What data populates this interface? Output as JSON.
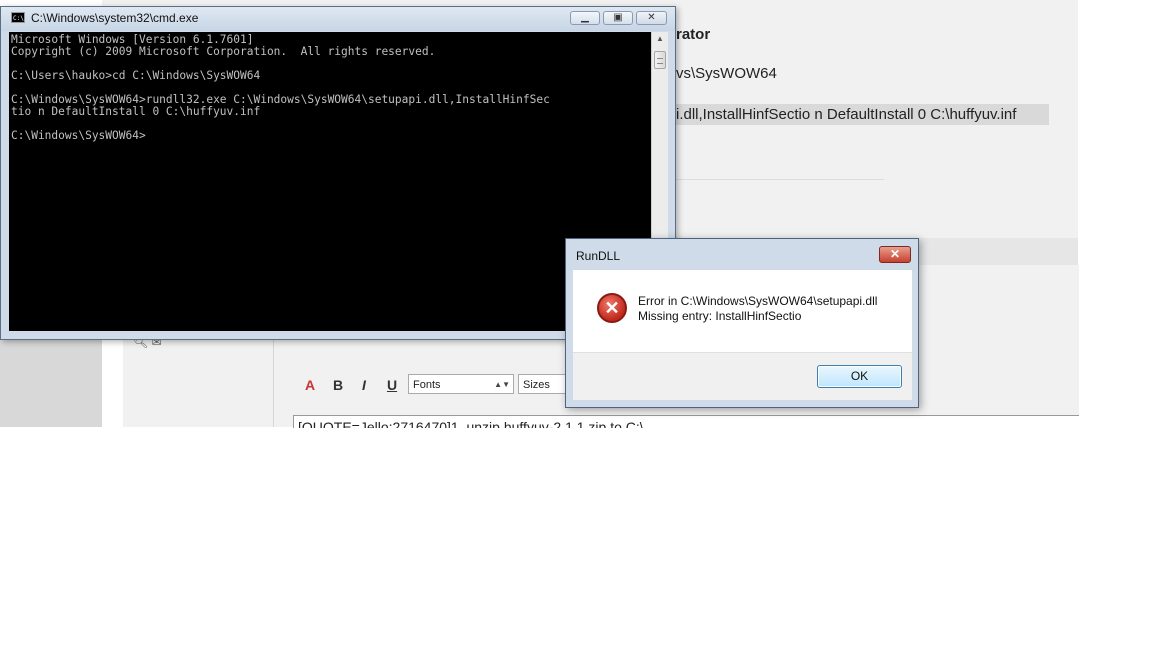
{
  "background_page": {
    "line1": "rator",
    "line2": "vs\\SysWOW64",
    "line3": "i.dll,InstallHinfSectio n DefaultInstall 0 C:\\huffyuv.inf",
    "editor": {
      "bold_label": "B",
      "italic_label": "I",
      "underline_label": "U",
      "font_label": "A",
      "fonts_select": "Fonts",
      "sizes_select": "Sizes",
      "textarea_text": "[QUOTE=Jello;2716470]1. unzip huffyuv-2.1.1.zip to C:\\"
    }
  },
  "cmd_window": {
    "title": "C:\\Windows\\system32\\cmd.exe",
    "icon_label": "C:\\",
    "minimize_glyph": "▁",
    "maximize_glyph": "▣",
    "close_glyph": "✕",
    "lines": [
      "Microsoft Windows [Version 6.1.7601]",
      "Copyright (c) 2009 Microsoft Corporation.  All rights reserved.",
      "",
      "C:\\Users\\hauko>cd C:\\Windows\\SysWOW64",
      "",
      "C:\\Windows\\SysWOW64>rundll32.exe C:\\Windows\\SysWOW64\\setupapi.dll,InstallHinfSec",
      "tio n DefaultInstall 0 C:\\huffyuv.inf",
      "",
      "C:\\Windows\\SysWOW64>"
    ]
  },
  "dialog": {
    "title": "RunDLL",
    "close_glyph": "✕",
    "icon_glyph": "✕",
    "message_line1": "Error in C:\\Windows\\SysWOW64\\setupapi.dll",
    "message_line2": "Missing entry: InstallHinfSectio",
    "ok_label": "OK"
  },
  "colors": {
    "console_bg": "#000000",
    "console_text": "#c0c0c0",
    "error_red": "#c0281c",
    "window_frame": "#cfdbe8"
  }
}
